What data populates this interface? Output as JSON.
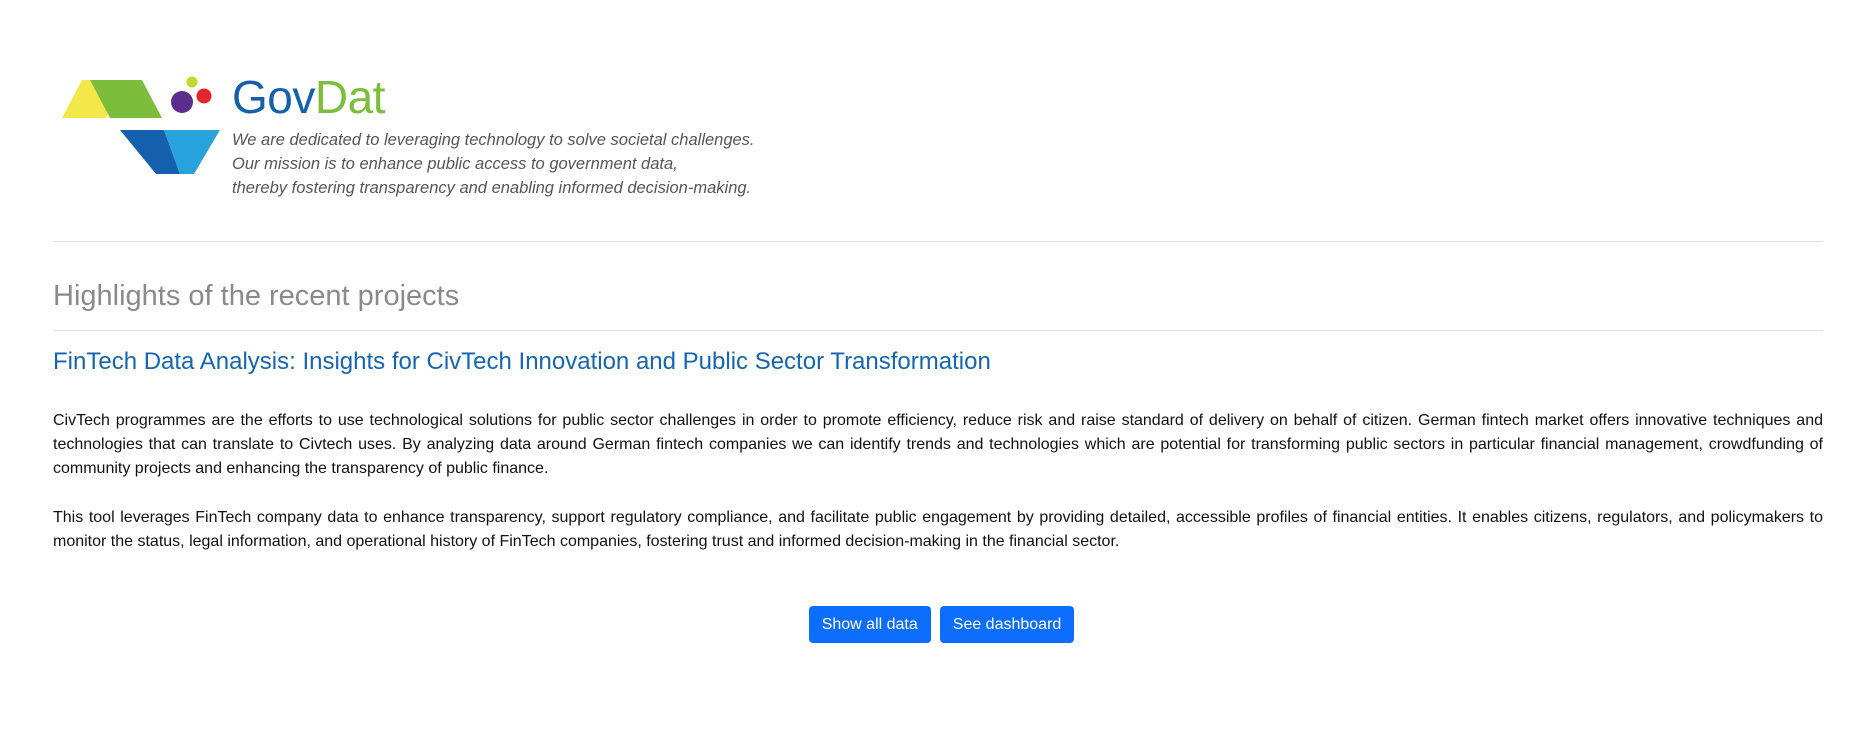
{
  "brand": {
    "name_part1": "Gov",
    "name_part2": "Dat",
    "tagline_lines": [
      "We are dedicated to leveraging technology to solve societal challenges.",
      "Our mission is to enhance public access to government data,",
      "thereby fostering transparency and enabling informed decision-making."
    ],
    "colors": {
      "gov_blue": "#1560ad",
      "dat_green": "#7dbd3c",
      "yellow": "#f3e84a",
      "green": "#7dbd3c",
      "dark_blue": "#1560ad",
      "light_blue": "#29a3dc",
      "purple": "#5b2d8e",
      "red": "#e4262d",
      "lime": "#c7d62f"
    }
  },
  "section": {
    "title": "Highlights of the recent projects"
  },
  "project": {
    "title": "FinTech Data Analysis: Insights for CivTech Innovation and Public Sector Transformation",
    "paragraphs": [
      "CivTech programmes are the efforts to use technological solutions for public sector challenges in order to promote efficiency, reduce risk and raise standard of delivery on behalf of citizen. German fintech market offers innovative techniques and technologies that can translate to Civtech uses. By analyzing data around German fintech companies we can identify trends and technologies which are potential for transforming public sectors in particular financial management, crowdfunding of community projects and enhancing the transparency of public finance.",
      "This tool leverages FinTech company data to enhance transparency, support regulatory compliance, and facilitate public engagement by providing detailed, accessible profiles of financial entities. It enables citizens, regulators, and policymakers to monitor the status, legal information, and operational history of FinTech companies, fostering trust and informed decision-making in the financial sector."
    ]
  },
  "actions": {
    "show_all_label": "Show all data",
    "dashboard_label": "See dashboard",
    "button_color": "#0d6efd"
  }
}
